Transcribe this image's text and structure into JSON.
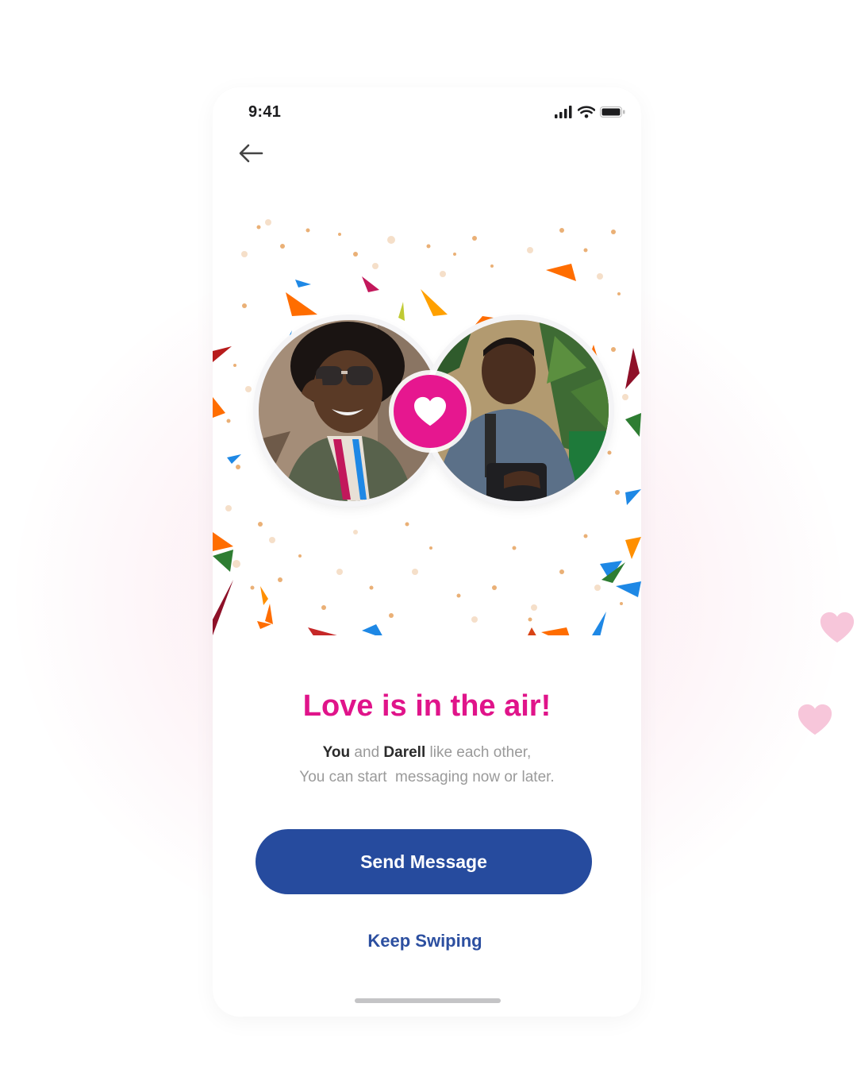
{
  "status_bar": {
    "time": "9:41"
  },
  "header": {
    "back_icon": "arrow-left-icon"
  },
  "match": {
    "title": "Love is in the air!",
    "line1": {
      "you": "You",
      "and": " and ",
      "name": "Darell",
      "rest": " like each other,"
    },
    "line2": "You can start  messaging now or later.",
    "left_avatar": "woman-with-sunglasses-avatar",
    "right_avatar": "man-with-suitcase-avatar",
    "badge_icon": "heart-icon"
  },
  "actions": {
    "send_message": "Send Message",
    "keep_swiping": "Keep Swiping"
  },
  "colors": {
    "accent_pink": "#e0148a",
    "primary_blue": "#264b9e",
    "link_blue": "#2c4fa0"
  }
}
